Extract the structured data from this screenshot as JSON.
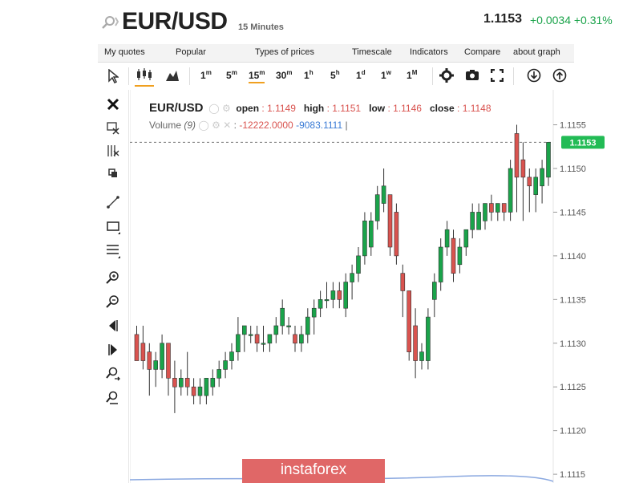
{
  "header": {
    "title": "EUR/USD",
    "timeframe": "15 Minutes",
    "last_price": "1.1153",
    "change": "+0.0034 +0.31%"
  },
  "menu": [
    "My quotes",
    "Popular",
    "Types of prices",
    "Timescale",
    "Indicators",
    "Compare",
    "about graph"
  ],
  "timeframes": [
    {
      "base": "1",
      "sup": "m"
    },
    {
      "base": "5",
      "sup": "m"
    },
    {
      "base": "15",
      "sup": "m"
    },
    {
      "base": "30",
      "sup": "m"
    },
    {
      "base": "1",
      "sup": "h"
    },
    {
      "base": "5",
      "sup": "h"
    },
    {
      "base": "1",
      "sup": "d"
    },
    {
      "base": "1",
      "sup": "w"
    },
    {
      "base": "1",
      "sup": "M"
    }
  ],
  "legend": {
    "symbol": "EUR/USD",
    "open_label": "open",
    "open": "1.1149",
    "high_label": "high",
    "high": "1.1151",
    "low_label": "low",
    "low": "1.1146",
    "close_label": "close",
    "close": "1.1148",
    "volume_label": "Volume",
    "volume_param": "(9)",
    "volume_val1": "-12222.0000",
    "volume_val2": "-9083.1111"
  },
  "watermark": "instaforex",
  "colors": {
    "up": "#1aa34a",
    "down": "#d9534f",
    "price_tag": "#22bb55"
  },
  "chart_data": {
    "type": "candlestick",
    "y_ticks": [
      "1.1155",
      "1.1150",
      "1.1145",
      "1.1140",
      "1.1135",
      "1.1130",
      "1.1125",
      "1.1120",
      "1.1115"
    ],
    "ylim": [
      1.1114,
      1.1159
    ],
    "current_price": 1.1153,
    "candles": [
      [
        1.1131,
        1.1132,
        1.1128,
        1.1128
      ],
      [
        1.113,
        1.1132,
        1.1127,
        1.1128
      ],
      [
        1.1129,
        1.113,
        1.1124,
        1.1127
      ],
      [
        1.1127,
        1.1129,
        1.1125,
        1.1128
      ],
      [
        1.1127,
        1.1131,
        1.1126,
        1.113
      ],
      [
        1.113,
        1.113,
        1.1124,
        1.1126
      ],
      [
        1.1126,
        1.1128,
        1.1122,
        1.1125
      ],
      [
        1.1125,
        1.1127,
        1.1124,
        1.1126
      ],
      [
        1.1126,
        1.1129,
        1.1124,
        1.1125
      ],
      [
        1.1125,
        1.1126,
        1.1123,
        1.1124
      ],
      [
        1.1124,
        1.1126,
        1.1123,
        1.1125
      ],
      [
        1.1124,
        1.1126,
        1.1123,
        1.1126
      ],
      [
        1.1125,
        1.1127,
        1.1124,
        1.1126
      ],
      [
        1.1126,
        1.1128,
        1.1125,
        1.1127
      ],
      [
        1.1127,
        1.1129,
        1.1126,
        1.1128
      ],
      [
        1.1128,
        1.113,
        1.1127,
        1.1129
      ],
      [
        1.1129,
        1.1133,
        1.1128,
        1.1131
      ],
      [
        1.1131,
        1.1132,
        1.1129,
        1.1132
      ],
      [
        1.1131,
        1.1132,
        1.113,
        1.1131
      ],
      [
        1.1131,
        1.1132,
        1.1129,
        1.113
      ],
      [
        1.113,
        1.1132,
        1.1129,
        1.113
      ],
      [
        1.113,
        1.1131,
        1.1129,
        1.1131
      ],
      [
        1.1131,
        1.1133,
        1.113,
        1.1132
      ],
      [
        1.1132,
        1.1135,
        1.1131,
        1.1134
      ],
      [
        1.1132,
        1.1133,
        1.1131,
        1.1132
      ],
      [
        1.1131,
        1.1132,
        1.1129,
        1.113
      ],
      [
        1.113,
        1.1132,
        1.1129,
        1.1131
      ],
      [
        1.1131,
        1.1134,
        1.113,
        1.1133
      ],
      [
        1.1133,
        1.1135,
        1.1131,
        1.1134
      ],
      [
        1.1134,
        1.1136,
        1.1133,
        1.1135
      ],
      [
        1.1135,
        1.1137,
        1.1134,
        1.1135
      ],
      [
        1.1135,
        1.1137,
        1.1134,
        1.1136
      ],
      [
        1.1136,
        1.1137,
        1.1134,
        1.1135
      ],
      [
        1.1134,
        1.1138,
        1.1133,
        1.1137
      ],
      [
        1.1137,
        1.1139,
        1.1135,
        1.1138
      ],
      [
        1.1138,
        1.1141,
        1.1137,
        1.114
      ],
      [
        1.114,
        1.1145,
        1.1139,
        1.1144
      ],
      [
        1.1141,
        1.1145,
        1.114,
        1.1144
      ],
      [
        1.1144,
        1.1148,
        1.1143,
        1.1147
      ],
      [
        1.1146,
        1.115,
        1.1145,
        1.1148
      ],
      [
        1.1147,
        1.1147,
        1.114,
        1.1141
      ],
      [
        1.1145,
        1.1146,
        1.1139,
        1.114
      ],
      [
        1.1138,
        1.1139,
        1.1133,
        1.1136
      ],
      [
        1.1136,
        1.1136,
        1.1128,
        1.1129
      ],
      [
        1.1132,
        1.1134,
        1.1126,
        1.1128
      ],
      [
        1.1128,
        1.113,
        1.1127,
        1.1129
      ],
      [
        1.1128,
        1.1134,
        1.1127,
        1.1133
      ],
      [
        1.1135,
        1.1138,
        1.1133,
        1.1137
      ],
      [
        1.1137,
        1.1142,
        1.1136,
        1.1141
      ],
      [
        1.1141,
        1.1144,
        1.114,
        1.1143
      ],
      [
        1.1142,
        1.1143,
        1.1137,
        1.1138
      ],
      [
        1.1139,
        1.1142,
        1.1138,
        1.1141
      ],
      [
        1.1141,
        1.1143,
        1.114,
        1.1143
      ],
      [
        1.1143,
        1.1146,
        1.1142,
        1.1145
      ],
      [
        1.1143,
        1.1146,
        1.1143,
        1.1145
      ],
      [
        1.1144,
        1.1146,
        1.1143,
        1.1146
      ],
      [
        1.1146,
        1.1147,
        1.1144,
        1.1145
      ],
      [
        1.1145,
        1.1146,
        1.1144,
        1.1146
      ],
      [
        1.1146,
        1.1146,
        1.1144,
        1.1145
      ],
      [
        1.1145,
        1.1151,
        1.1144,
        1.115
      ],
      [
        1.1154,
        1.1155,
        1.1145,
        1.1149
      ],
      [
        1.1151,
        1.1153,
        1.1144,
        1.1149
      ],
      [
        1.1149,
        1.115,
        1.1145,
        1.1148
      ],
      [
        1.1147,
        1.115,
        1.1145,
        1.1149
      ],
      [
        1.1148,
        1.1151,
        1.1146,
        1.115
      ],
      [
        1.1149,
        1.1153,
        1.1148,
        1.1153
      ]
    ]
  }
}
